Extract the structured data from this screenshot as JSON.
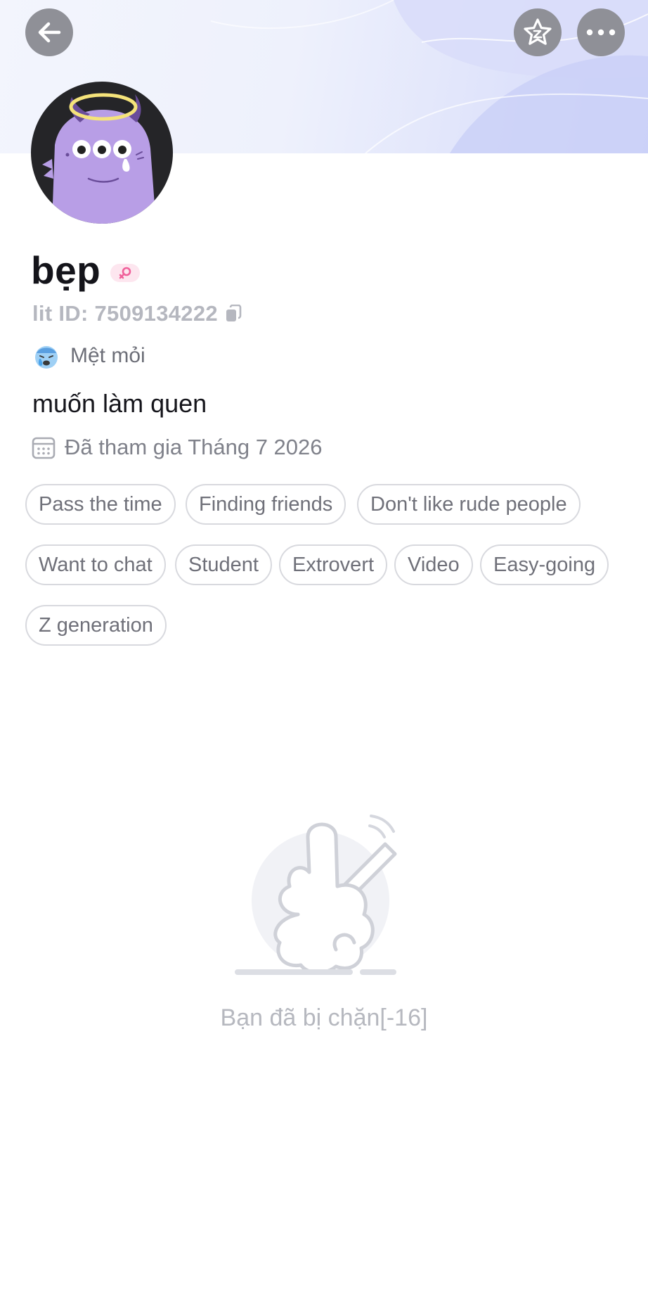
{
  "header": {
    "back_icon": "arrow-left-icon",
    "favorite_icon": "star-icon",
    "more_icon": "more-horizontal-icon"
  },
  "profile": {
    "username": "bẹp",
    "gender_icon": "female-symbol-icon",
    "lit_id": "lit ID: 7509134222",
    "mood_emoji": "😰",
    "mood": "Mệt mỏi",
    "bio": "muốn làm quen",
    "joined": "Đã tham gia Tháng 7 2026"
  },
  "tags": [
    "Pass the time",
    "Finding friends",
    "Don't like rude people",
    "Want to chat",
    "Student",
    "Extrovert",
    "Video",
    "Easy-going",
    "Z generation"
  ],
  "blocked": {
    "message": "Bạn đã bị chặn[-16]"
  },
  "colors": {
    "header_gradient_end": "#d3d8fa",
    "button_bg": "#8f9097",
    "avatar_monster": "#b89ee6",
    "tag_border": "#d8d9de",
    "muted_text": "#b6b8bf"
  }
}
